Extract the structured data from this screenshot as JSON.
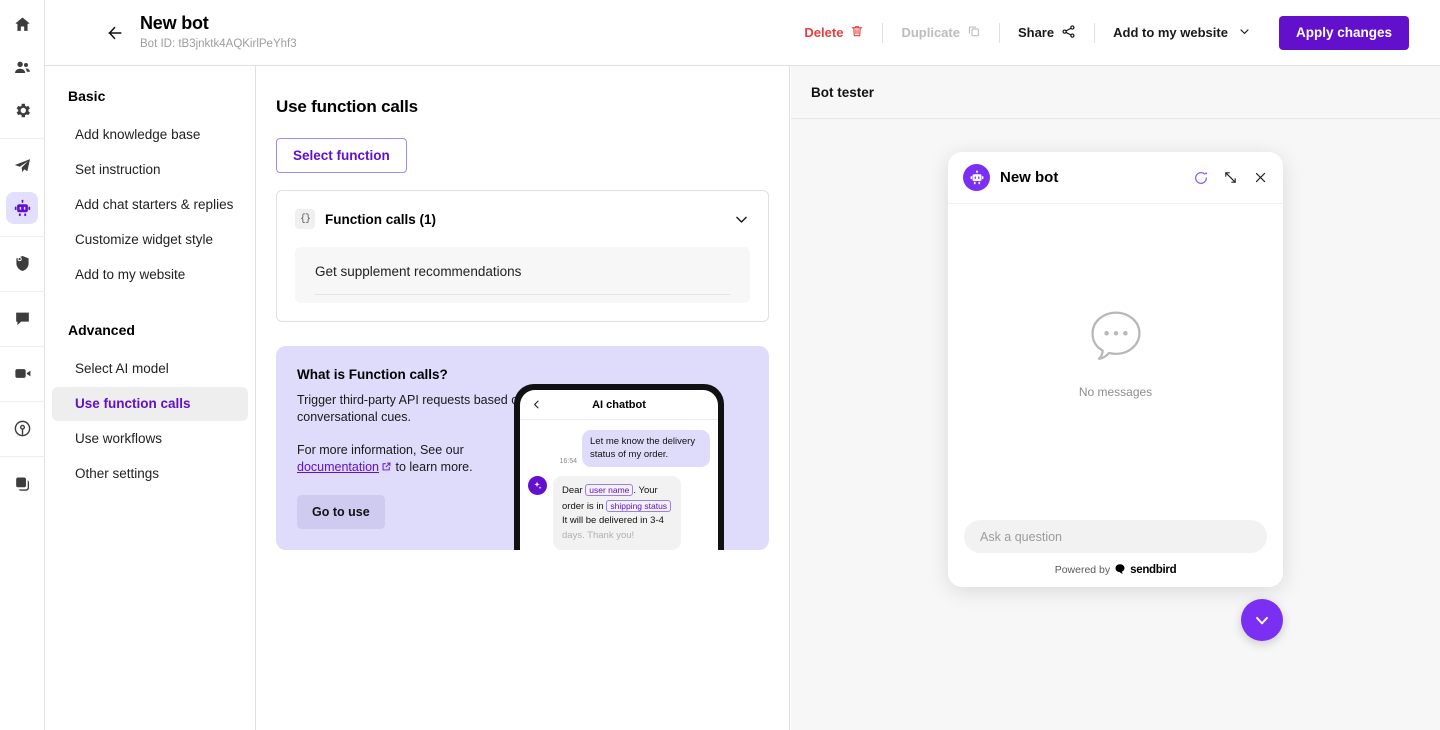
{
  "rail": {
    "items": [
      {
        "name": "home-icon",
        "label": "Home",
        "active": false
      },
      {
        "name": "users-icon",
        "label": "Users",
        "active": false
      },
      {
        "name": "gear-icon",
        "label": "Settings",
        "active": false
      },
      {
        "name": "send-icon",
        "label": "Campaigns",
        "active": false
      },
      {
        "name": "robot-icon",
        "label": "AI Chatbot",
        "active": true
      },
      {
        "name": "shield-check-icon",
        "label": "Support",
        "active": false
      },
      {
        "name": "chat-bubble-icon",
        "label": "Chat",
        "active": false
      },
      {
        "name": "video-camera-icon",
        "label": "Calls",
        "active": false
      },
      {
        "name": "broadcast-icon",
        "label": "Notifications",
        "active": false
      },
      {
        "name": "layers-icon",
        "label": "Desk",
        "active": false
      }
    ]
  },
  "header": {
    "back_label": "Back",
    "title": "New bot",
    "bot_id": "Bot ID: tB3jnktk4AQKirlPeYhf3",
    "actions": {
      "delete": "Delete",
      "duplicate": "Duplicate",
      "share": "Share",
      "add_to_website": "Add to my website",
      "apply": "Apply changes"
    },
    "accent_color": "#6210CC",
    "delete_color": "#E53E3E",
    "disabled_color": "#bdbdbd"
  },
  "sidebar": {
    "groups": [
      {
        "title": "Basic",
        "items": [
          {
            "label": "Add knowledge base",
            "active": false
          },
          {
            "label": "Set instruction",
            "active": false
          },
          {
            "label": "Add chat starters & replies",
            "active": false
          },
          {
            "label": "Customize widget style",
            "active": false
          },
          {
            "label": "Add to my website",
            "active": false
          }
        ]
      },
      {
        "title": "Advanced",
        "items": [
          {
            "label": "Select AI model",
            "active": false
          },
          {
            "label": "Use function calls",
            "active": true
          },
          {
            "label": "Use workflows",
            "active": false
          },
          {
            "label": "Other settings",
            "active": false
          }
        ]
      }
    ]
  },
  "main": {
    "section_title": "Use function calls",
    "select_function_button": "Select function",
    "function_card": {
      "badge_glyph": "{}",
      "title": "Function calls (1)",
      "expanded": true,
      "rows": [
        {
          "label": "Get supplement recommendations"
        }
      ]
    },
    "promo": {
      "heading": "What is Function calls?",
      "paragraph_1": "Trigger third-party API requests based on conversational cues.",
      "paragraph_2_before": "For more information, See our ",
      "link": "documentation",
      "paragraph_2_after": " to learn more.",
      "button": "Go to use",
      "bg_color": "#DFDBFA",
      "phone": {
        "title": "AI chatbot",
        "user_message": "Let me know the delivery status of my order.",
        "timestamp": "16:54",
        "bot_message_part_1": "Dear",
        "bot_token_1": "user name",
        "bot_message_part_2": ". Your order is in",
        "bot_token_2": "shipping status",
        "bot_message_part_3": "It will be delivered in 3-4",
        "bot_message_part_4": "days. Thank you!"
      }
    }
  },
  "tester": {
    "panel_title": "Bot tester",
    "widget": {
      "title": "New bot",
      "refresh_label": "Restart conversation",
      "expand_label": "Expand",
      "close_label": "Close",
      "empty_state": "No messages",
      "input_placeholder": "Ask a question",
      "input_value": "",
      "powered_by_prefix": "Powered by",
      "powered_by_brand": "sendbird"
    },
    "fab_label": "Minimize chat",
    "accent_color": "#7B2FF2"
  }
}
